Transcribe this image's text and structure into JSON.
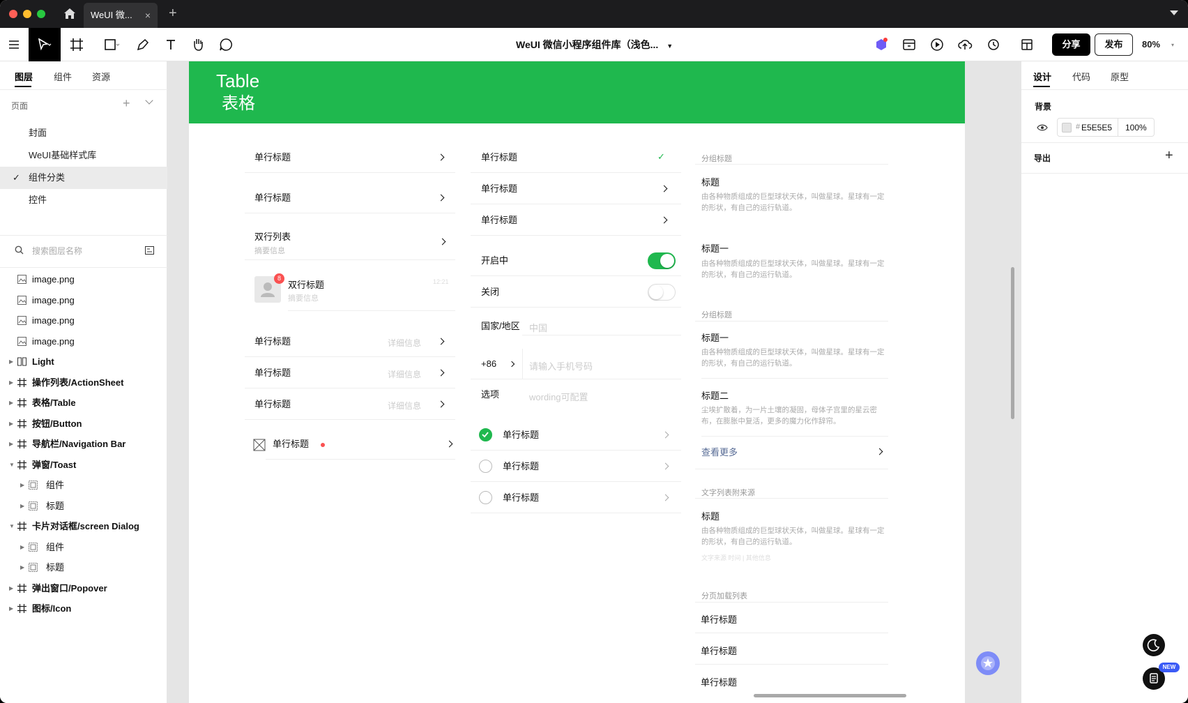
{
  "window": {
    "tab_title": "WeUI 微...",
    "tab_close": "×",
    "new_tab": "+"
  },
  "toolbar": {
    "doc_title": "WeUI 微信小程序组件库（浅色...",
    "share_label": "分享",
    "publish_label": "发布",
    "zoom": "80%"
  },
  "left_panel": {
    "tabs": [
      "图层",
      "组件",
      "资源"
    ],
    "pages_header": "页面",
    "pages": [
      {
        "label": "封面",
        "selected": false
      },
      {
        "label": "WeUI基础样式库",
        "selected": false
      },
      {
        "label": "组件分类",
        "selected": true
      },
      {
        "label": "控件",
        "selected": false
      }
    ],
    "search_placeholder": "搜索图层名称",
    "layers": [
      {
        "label": "image.png",
        "icon": "image-icon",
        "caret": false,
        "indent": 0
      },
      {
        "label": "image.png",
        "icon": "image-icon",
        "caret": false,
        "indent": 0
      },
      {
        "label": "image.png",
        "icon": "image-icon",
        "caret": false,
        "indent": 0
      },
      {
        "label": "image.png",
        "icon": "image-icon",
        "caret": false,
        "indent": 0
      },
      {
        "label": "Light",
        "icon": "columns-icon",
        "caret": "right",
        "indent": 0
      },
      {
        "label": "操作列表/ActionSheet",
        "icon": "frame-icon",
        "caret": "right",
        "indent": 0
      },
      {
        "label": "表格/Table",
        "icon": "frame-icon",
        "caret": "right",
        "indent": 0
      },
      {
        "label": "按钮/Button",
        "icon": "frame-icon",
        "caret": "right",
        "indent": 0
      },
      {
        "label": "导航栏/Navigation Bar",
        "icon": "frame-icon",
        "caret": "right",
        "indent": 0
      },
      {
        "label": "弹窗/Toast",
        "icon": "frame-icon",
        "caret": "down",
        "indent": 0
      },
      {
        "label": "组件",
        "icon": "component-icon",
        "caret": "right",
        "indent": 1
      },
      {
        "label": "标题",
        "icon": "component-icon",
        "caret": "right",
        "indent": 1
      },
      {
        "label": "卡片对话框/screen Dialog",
        "icon": "frame-icon",
        "caret": "down",
        "indent": 0
      },
      {
        "label": "组件",
        "icon": "component-icon",
        "caret": "right",
        "indent": 1
      },
      {
        "label": "标题",
        "icon": "component-icon",
        "caret": "right",
        "indent": 1
      },
      {
        "label": "弹出窗口/Popover",
        "icon": "frame-icon",
        "caret": "right",
        "indent": 0
      },
      {
        "label": "图标/Icon",
        "icon": "frame-icon",
        "caret": "right",
        "indent": 0
      }
    ]
  },
  "right_panel": {
    "tabs": [
      "设计",
      "代码",
      "原型"
    ],
    "background_label": "背景",
    "bg_hash": "#",
    "bg_color": "E5E5E5",
    "bg_opacity": "100%",
    "export_label": "导出",
    "export_add": "+"
  },
  "board": {
    "title_en": "Table",
    "title_cn": "表格",
    "col1": {
      "rows": [
        {
          "label": "单行标题"
        },
        {
          "label": "单行标题"
        },
        {
          "label": "双行列表",
          "sub": "摘要信息"
        },
        {
          "label": "双行标题",
          "sub": "摘要信息",
          "time": "12:21",
          "badge": "8"
        },
        {
          "label": "单行标题",
          "detail": "详细信息"
        },
        {
          "label": "单行标题",
          "detail": "详细信息"
        },
        {
          "label": "单行标题",
          "detail": "详细信息"
        },
        {
          "label": "单行标题"
        }
      ]
    },
    "col2": {
      "rows": [
        {
          "label": "单行标题",
          "check": "✓"
        },
        {
          "label": "单行标题"
        },
        {
          "label": "单行标题"
        }
      ],
      "switches": [
        {
          "label": "开启中",
          "on": true
        },
        {
          "label": "关闭",
          "on": false
        }
      ],
      "form": {
        "country_label": "国家/地区",
        "country_value": "中国",
        "code": "+86",
        "phone_placeholder": "请输入手机号码",
        "option_label": "选项",
        "option_placeholder": "wording可配置"
      },
      "radios": [
        {
          "label": "单行标题",
          "checked": true
        },
        {
          "label": "单行标题",
          "checked": false
        },
        {
          "label": "单行标题",
          "checked": false
        }
      ]
    },
    "col3": {
      "group1_header": "分组标题",
      "item1": {
        "title": "标题",
        "desc": "由各种物质组成的巨型球状天体，叫做星球。星球有一定的形状，有自己的运行轨道。"
      },
      "item2": {
        "title": "标题一",
        "desc": "由各种物质组成的巨型球状天体，叫做星球。星球有一定的形状，有自己的运行轨道。"
      },
      "group2_header": "分组标题",
      "item3": {
        "title": "标题一",
        "desc": "由各种物质组成的巨型球状天体，叫做星球。星球有一定的形状，有自己的运行轨道。"
      },
      "item4": {
        "title": "标题二",
        "desc": "尘埃扩散着，为一片土壤的凝固，母体子宫里的星云密布，在膨胀中复活，更多的魔力化作辞帘。"
      },
      "more_link": "查看更多",
      "group3_header": "文字列表附来源",
      "item5": {
        "title": "标题",
        "desc": "由各种物质组成的巨型球状天体，叫做星球。星球有一定的形状，有自己的运行轨道。",
        "meta": "文字来源  时间  |  其他信息"
      },
      "group4_header": "分页加载列表",
      "paged": [
        "单行标题",
        "单行标题",
        "单行标题"
      ]
    }
  },
  "colors": {
    "accent": "#1FB84E",
    "canvas_bg": "#E5E5E5",
    "badge_red": "#FA5151",
    "link_blue": "#576B95"
  },
  "badges": {
    "new": "NEW"
  }
}
